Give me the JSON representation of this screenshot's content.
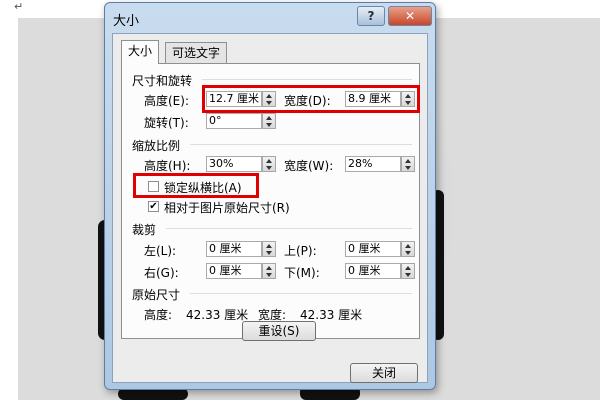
{
  "background": {
    "paragraph_mark": "↵"
  },
  "dialog": {
    "title": "大小",
    "help_glyph": "?",
    "close_glyph": "✕",
    "tabs": [
      {
        "label": "大小"
      },
      {
        "label": "可选文字"
      }
    ],
    "size_rotate": {
      "heading": "尺寸和旋转",
      "height_label": "高度(E):",
      "height_value": "12.7 厘米",
      "width_label": "宽度(D):",
      "width_value": "8.9 厘米",
      "rotate_label": "旋转(T):",
      "rotate_value": "0°"
    },
    "scale": {
      "heading": "缩放比例",
      "height_label": "高度(H):",
      "height_value": "30%",
      "width_label": "宽度(W):",
      "width_value": "28%",
      "lock_aspect_label": "锁定纵横比(A)",
      "lock_aspect_checked": false,
      "relative_label": "相对于图片原始尺寸(R)",
      "relative_checked": true
    },
    "crop": {
      "heading": "裁剪",
      "left_label": "左(L):",
      "left_value": "0 厘米",
      "top_label": "上(P):",
      "top_value": "0 厘米",
      "right_label": "右(G):",
      "right_value": "0 厘米",
      "bottom_label": "下(M):",
      "bottom_value": "0 厘米"
    },
    "original": {
      "heading": "原始尺寸",
      "height_label": "高度:",
      "height_value": "42.33 厘米",
      "width_label": "宽度:",
      "width_value": "42.33 厘米",
      "reset_label": "重设(S)"
    },
    "close_label": "关闭"
  },
  "colors": {
    "highlight": "#e00000"
  }
}
